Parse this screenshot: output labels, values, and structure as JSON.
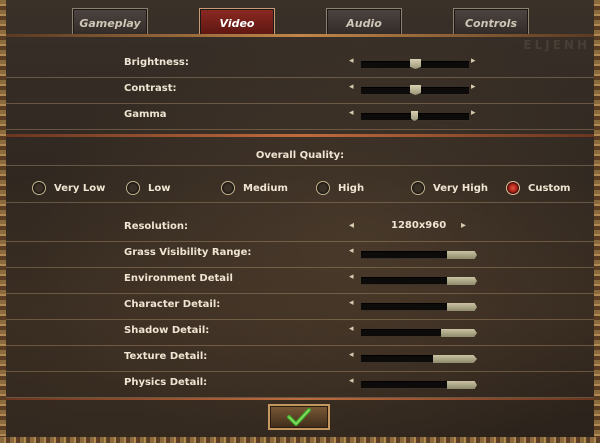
{
  "tabs": [
    {
      "label": "Gameplay",
      "active": false
    },
    {
      "label": "Video",
      "active": true
    },
    {
      "label": "Audio",
      "active": false
    },
    {
      "label": "Controls",
      "active": false
    }
  ],
  "watermark": "ELJENH",
  "image_sliders": [
    {
      "label": "Brightness:",
      "value_fraction": 0.5
    },
    {
      "label": "Contrast:",
      "value_fraction": 0.5
    },
    {
      "label": "Gamma",
      "value_fraction": 0.5
    }
  ],
  "overall_quality": {
    "label": "Overall Quality:",
    "options": [
      "Very Low",
      "Low",
      "Medium",
      "High",
      "Very High",
      "Custom"
    ],
    "selected": "Custom"
  },
  "resolution": {
    "label": "Resolution:",
    "value": "1280x960"
  },
  "detail_sliders": [
    {
      "label": "Grass Visibility Range:",
      "value_fraction": 1.0
    },
    {
      "label": "Environment Detail",
      "value_fraction": 1.0
    },
    {
      "label": "Character Detail:",
      "value_fraction": 1.0
    },
    {
      "label": "Shadow Detail:",
      "value_fraction": 1.0
    },
    {
      "label": "Texture Detail:",
      "value_fraction": 1.0
    },
    {
      "label": "Physics Detail:",
      "value_fraction": 1.0
    }
  ],
  "confirm_button": {
    "icon": "checkmark-icon"
  },
  "colors": {
    "accent_red": "#8b2a22",
    "check_green": "#3fae2a"
  }
}
